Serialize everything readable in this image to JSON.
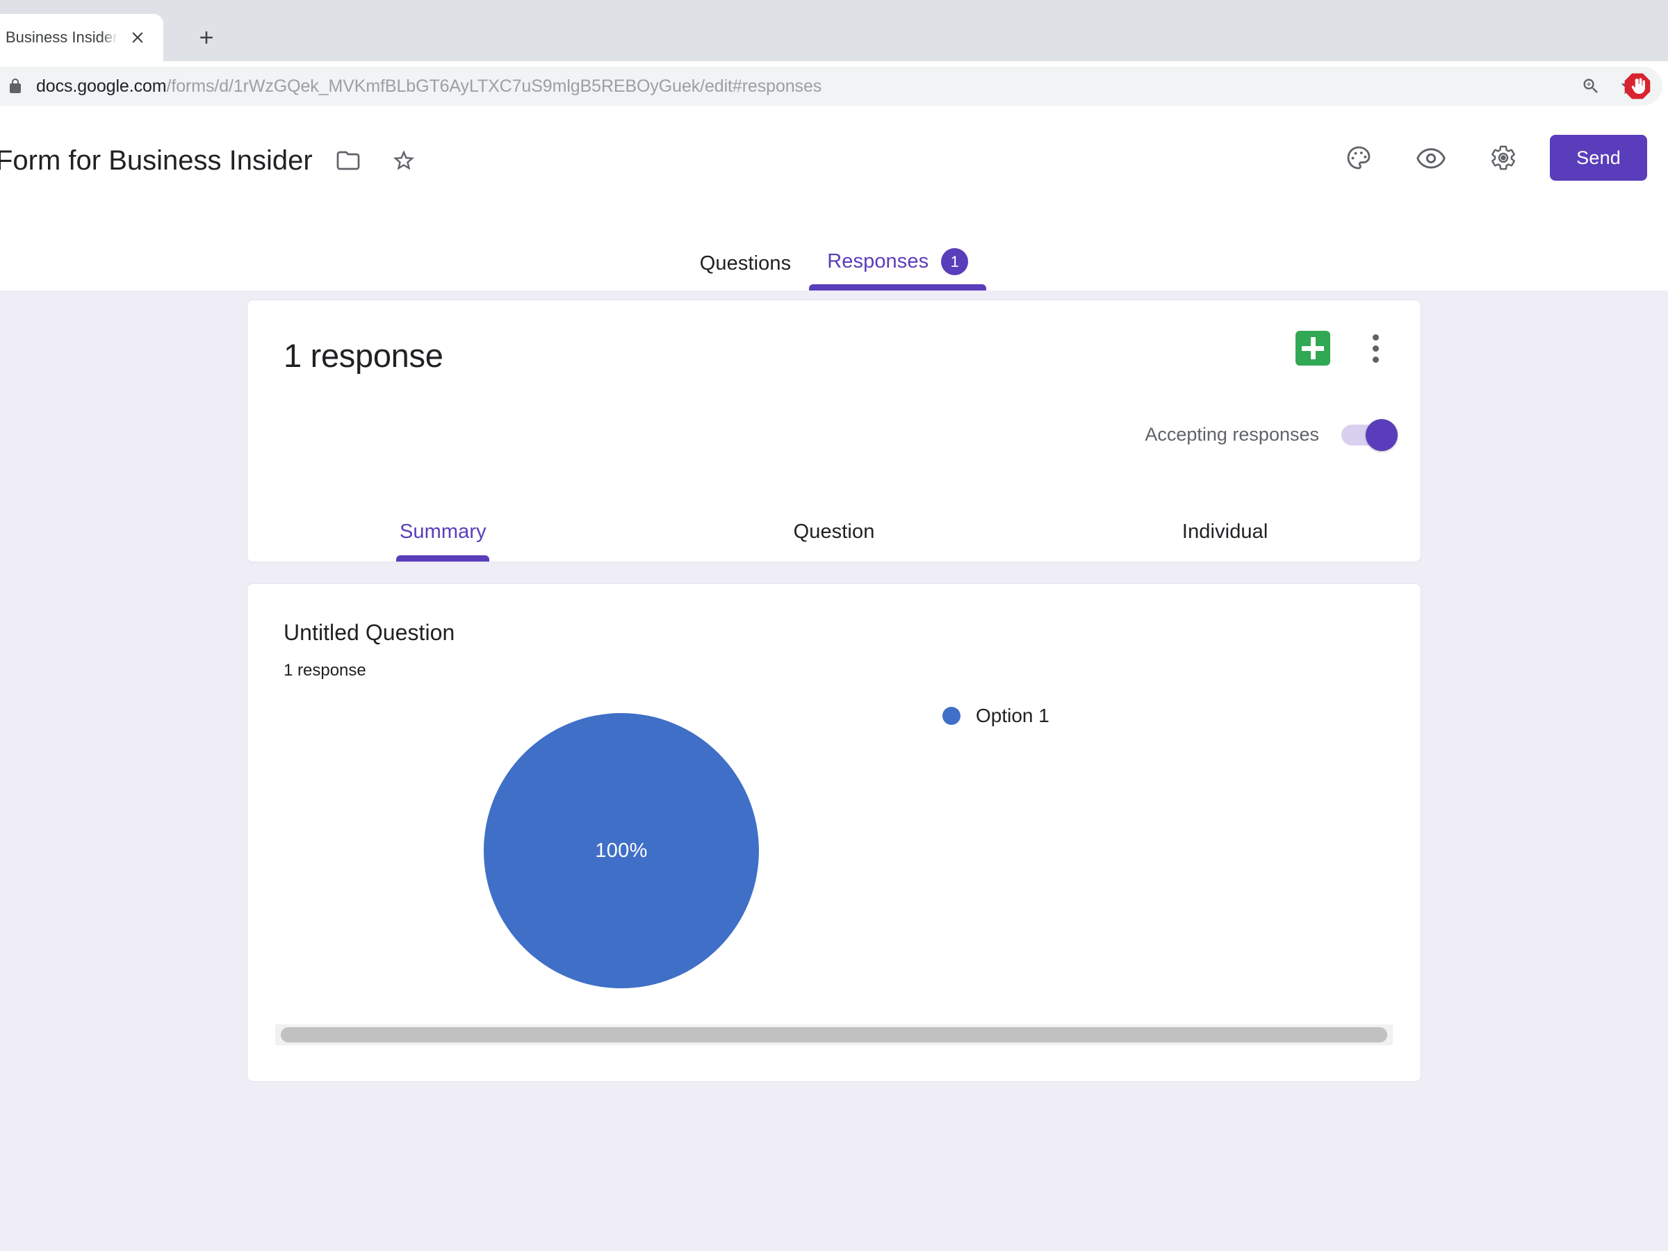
{
  "browser": {
    "tab": {
      "title": "Business Insider",
      "close_icon": "close-icon"
    },
    "new_tab_icon": "plus-icon",
    "omnibox": {
      "lock_icon": "lock-icon",
      "url_host": "docs.google.com",
      "url_path": "/forms/d/1rWzGQek_MVKmfBLbGT6AyLTXC7uS9mlgB5REBOyGuek/edit#responses",
      "zoom_icon": "zoom-in-icon",
      "bookmark_icon": "star-outline-icon"
    },
    "extensions": [
      {
        "name": "adblock-icon",
        "label": ""
      },
      {
        "name": "extension-h-icon",
        "label": "h"
      }
    ]
  },
  "forms": {
    "title": "Form for Business Insider",
    "folder_icon": "folder-icon",
    "star_icon": "star-outline-icon",
    "header_actions": [
      {
        "icon": "palette-icon"
      },
      {
        "icon": "eye-preview-icon"
      },
      {
        "icon": "gear-settings-icon"
      }
    ],
    "send_label": "Send",
    "accent_color": "#5A3DBA",
    "tabs": [
      {
        "label": "Questions",
        "active": false,
        "badge": null
      },
      {
        "label": "Responses",
        "active": true,
        "badge": "1"
      }
    ]
  },
  "summary": {
    "response_count_label": "1 response",
    "sheets_icon": "google-sheets-create-icon",
    "kebab_icon": "more-vert-icon",
    "accepting_label": "Accepting responses",
    "accepting_on": true,
    "sub_tabs": [
      {
        "label": "Summary",
        "active": true
      },
      {
        "label": "Question",
        "active": false
      },
      {
        "label": "Individual",
        "active": false
      }
    ]
  },
  "question": {
    "title": "Untitled Question",
    "response_label": "1 response"
  },
  "chart_data": {
    "type": "pie",
    "title": "Untitled Question",
    "categories": [
      "Option 1"
    ],
    "values": [
      1
    ],
    "percentages": [
      "100%"
    ],
    "colors": [
      "#3F6FC7"
    ],
    "legend_position": "right",
    "labels_inside": true
  }
}
